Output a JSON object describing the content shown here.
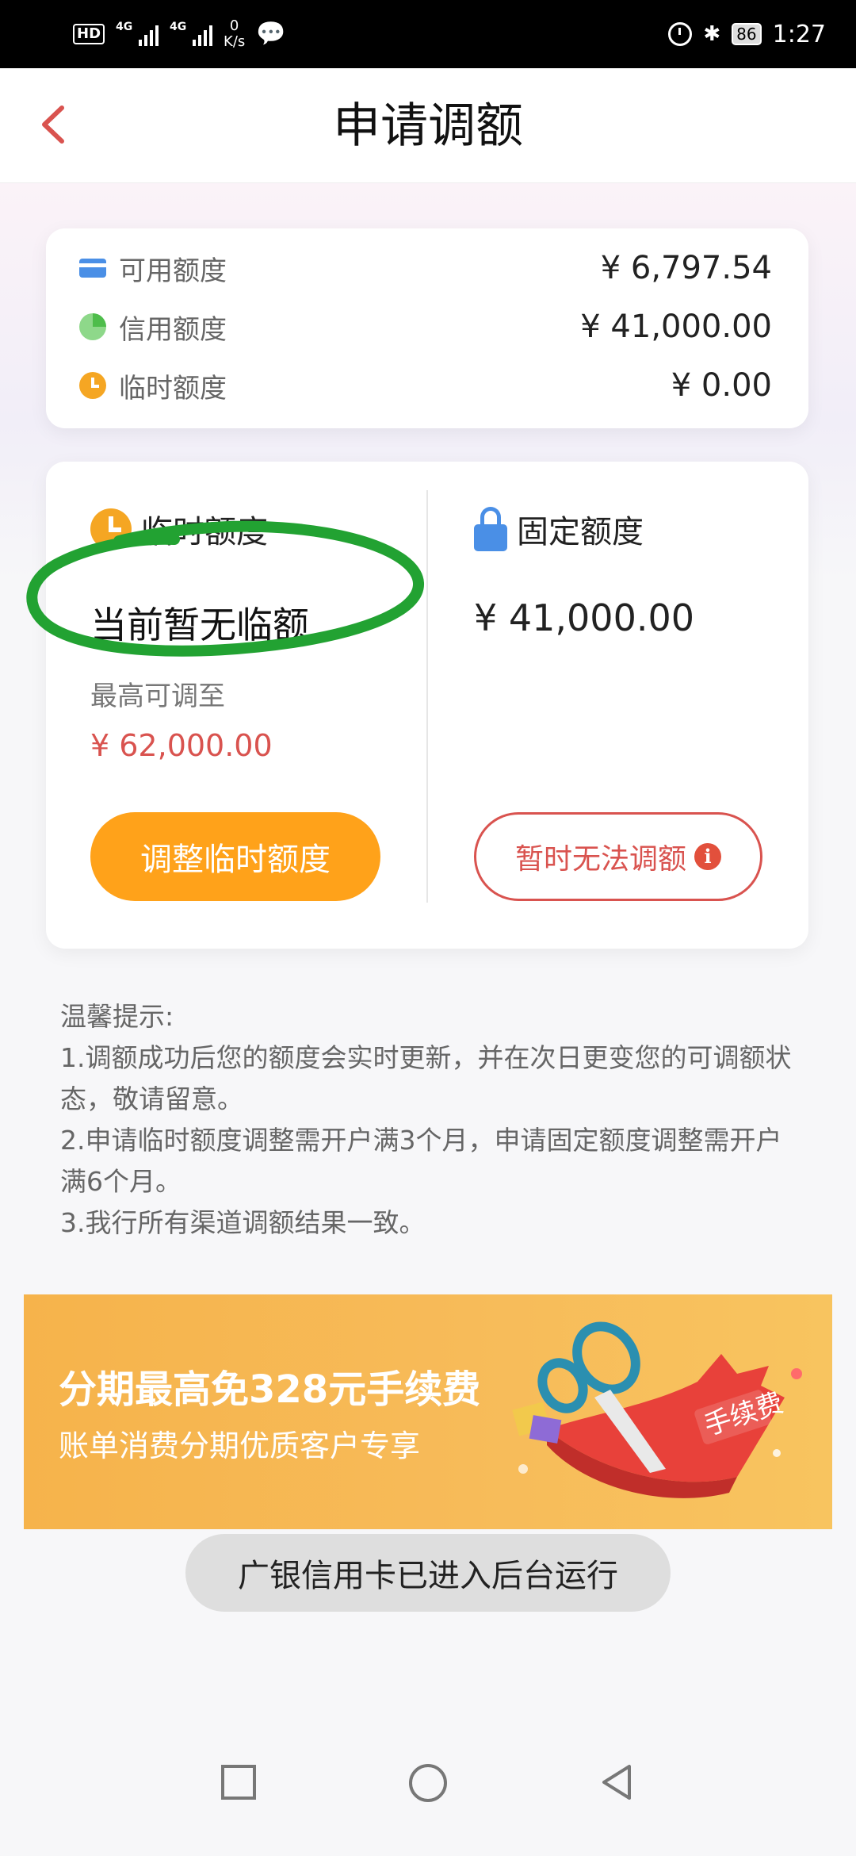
{
  "status_bar": {
    "hd": "HD",
    "signal1": "4G",
    "signal2": "4G",
    "speed_value": "0",
    "speed_unit": "K/s",
    "battery": "86",
    "time": "1:27"
  },
  "header": {
    "title": "申请调额"
  },
  "summary": {
    "rows": [
      {
        "label": "可用额度",
        "value": "¥ 6,797.54",
        "icon": "card-icon"
      },
      {
        "label": "信用额度",
        "value": "¥ 41,000.00",
        "icon": "pie-icon"
      },
      {
        "label": "临时额度",
        "value": "¥ 0.00",
        "icon": "clock-icon"
      }
    ]
  },
  "temp": {
    "title": "临时额度",
    "status": "当前暂无临额",
    "max_label": "最高可调至",
    "max_value": "¥ 62,000.00",
    "button": "调整临时额度"
  },
  "fixed": {
    "title": "固定额度",
    "value": "¥ 41,000.00",
    "button": "暂时无法调额"
  },
  "tips": {
    "title": "温馨提示:",
    "items": [
      "1.调额成功后您的额度会实时更新，并在次日更变您的可调额状态，敬请留意。",
      "2.申请临时额度调整需开户满3个月，申请固定额度调整需开户满6个月。",
      "3.我行所有渠道调额结果一致。"
    ]
  },
  "banner": {
    "line1": "分期最高免328元手续费",
    "line2": "账单消费分期优质客户专享",
    "badge": "手续费"
  },
  "toast": "广银信用卡已进入后台运行",
  "colors": {
    "accent_orange": "#ffa21a",
    "accent_red": "#d9534f",
    "icon_blue": "#4a8fe6",
    "annotation_green": "#22a232"
  }
}
